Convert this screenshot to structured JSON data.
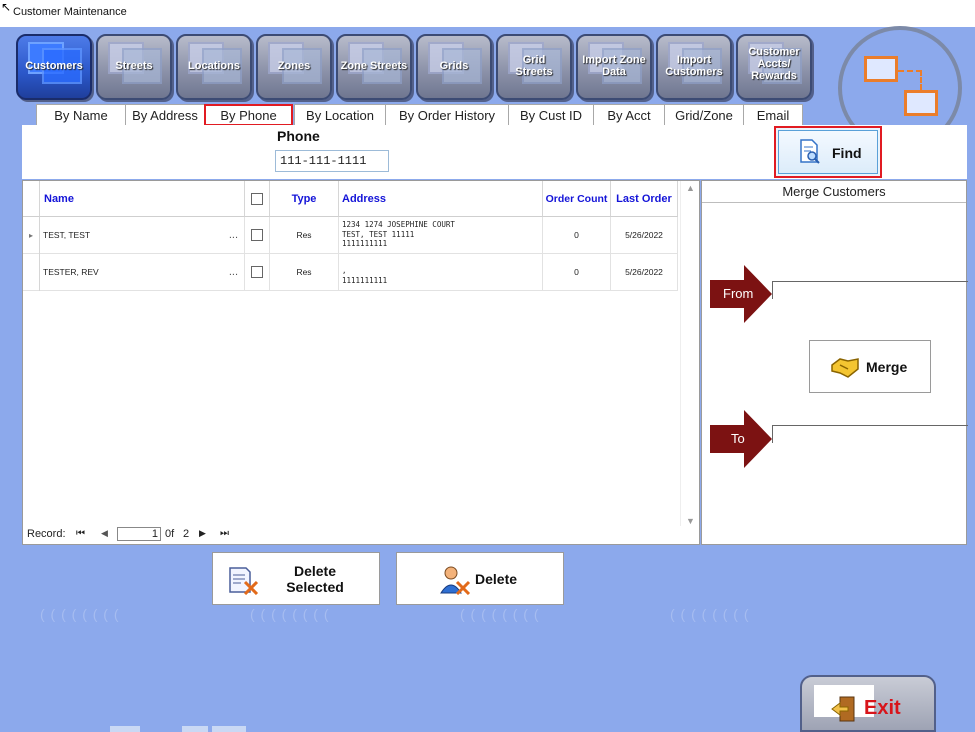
{
  "window": {
    "title": "Customer Maintenance"
  },
  "nav": {
    "tiles": [
      {
        "label": "Customers",
        "icon": "customers-icon"
      },
      {
        "label": "Streets",
        "icon": "streets-icon"
      },
      {
        "label": "Locations",
        "icon": "locations-icon"
      },
      {
        "label": "Zones",
        "icon": "zones-icon"
      },
      {
        "label": "Zone Streets",
        "icon": "zone-streets-icon"
      },
      {
        "label": "Grids",
        "icon": "grids-icon"
      },
      {
        "label": "Grid Streets",
        "icon": "grid-streets-icon"
      },
      {
        "label": "Import Zone Data",
        "icon": "import-zone-icon"
      },
      {
        "label": "Import Customers",
        "icon": "import-customers-icon"
      },
      {
        "label": "Customer Accts/ Rewards",
        "icon": "rewards-icon"
      }
    ],
    "active": "Customers"
  },
  "search": {
    "tabs": [
      "By Name",
      "By Address",
      "By Phone",
      "By Location",
      "By Order History",
      "By Cust ID",
      "By Acct",
      "Grid/Zone",
      "Email"
    ],
    "selected_tab": "By Phone",
    "phone_label": "Phone",
    "phone_value": "111-111-1111",
    "find_label": "Find"
  },
  "grid": {
    "columns": {
      "name": "Name",
      "type": "Type",
      "address": "Address",
      "order_count": "Order Count",
      "last_order": "Last Order"
    },
    "rows": [
      {
        "name": "TEST, TEST",
        "ellipsis": "...",
        "type": "Res",
        "address1": "1234 1274 JOSEPHINE COURT",
        "address2": "TEST, TEST 11111",
        "address3": "1111111111",
        "order_count": "0",
        "last_order": "5/26/2022",
        "indicator": "▸"
      },
      {
        "name": "TESTER, REV",
        "ellipsis": "...",
        "type": "Res",
        "address1": ",",
        "address2": "1111111111",
        "address3": "",
        "order_count": "0",
        "last_order": "5/26/2022",
        "indicator": ""
      }
    ],
    "record": {
      "label": "Record:",
      "current": "1",
      "of": "0f",
      "total": "2"
    }
  },
  "merge": {
    "header": "Merge Customers",
    "from_label": "From",
    "to_label": "To",
    "merge_label": "Merge"
  },
  "actions": {
    "delete_selected": "Delete Selected",
    "delete": "Delete",
    "exit": "Exit"
  },
  "colors": {
    "background": "#8ca9ec",
    "highlight": "#e11b22",
    "header_text": "#1414d8",
    "arrow": "#7c1212",
    "exit_text": "#d8141a"
  }
}
